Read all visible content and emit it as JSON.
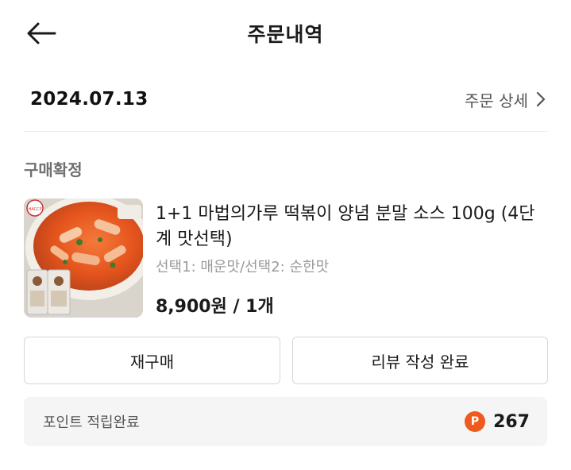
{
  "header": {
    "title": "주문내역"
  },
  "order": {
    "date": "2024.07.13",
    "detail_link": "주문 상세"
  },
  "status": "구매확정",
  "product": {
    "name": "1+1 마법의가루 떡볶이 양념 분말 소스 100g (4단계 맛선택)",
    "option": "선택1: 매운맛/선택2: 순한맛",
    "price": "8,900원 / 1개",
    "thumb_badge": "HACCP"
  },
  "buttons": {
    "reorder": "재구매",
    "review": "리뷰 작성 완료"
  },
  "points": {
    "label": "포인트 적립완료",
    "badge": "P",
    "value": "267"
  },
  "colors": {
    "accent": "#ef5a1f",
    "muted_text": "#9a9a9a",
    "points_bg": "#f5f5f5"
  },
  "icons": {
    "back": "arrow-left-icon",
    "detail": "chevron-right-icon",
    "points": "points-badge-icon"
  }
}
